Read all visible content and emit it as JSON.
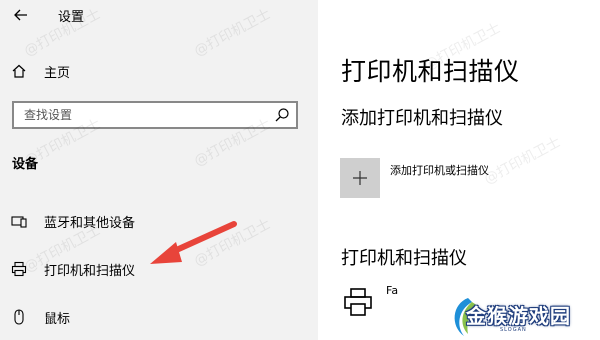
{
  "window": {
    "title": "设置"
  },
  "sidebar": {
    "home": {
      "label": "主页"
    },
    "search": {
      "placeholder": "查找设置"
    },
    "section_title": "设备",
    "items": [
      {
        "label": "蓝牙和其他设备",
        "icon": "bluetooth-devices-icon"
      },
      {
        "label": "打印机和扫描仪",
        "icon": "printer-icon"
      },
      {
        "label": "鼠标",
        "icon": "mouse-icon"
      }
    ]
  },
  "main": {
    "title": "打印机和扫描仪",
    "add_section_title": "添加打印机和扫描仪",
    "add_button_label": "添加打印机或扫描仪",
    "list_title": "打印机和扫描仪",
    "printers": [
      {
        "name": "Fa"
      }
    ]
  },
  "watermark": {
    "text": "@打印机卫士"
  },
  "logo": {
    "text": "金猴游戏园",
    "subtext": "SLOGAN"
  },
  "colors": {
    "sidebar_bg": "#f2f2f2",
    "tile_bg": "#cfcfcf",
    "arrow": "#e8443a",
    "logo_blue": "#1e3c7c"
  }
}
